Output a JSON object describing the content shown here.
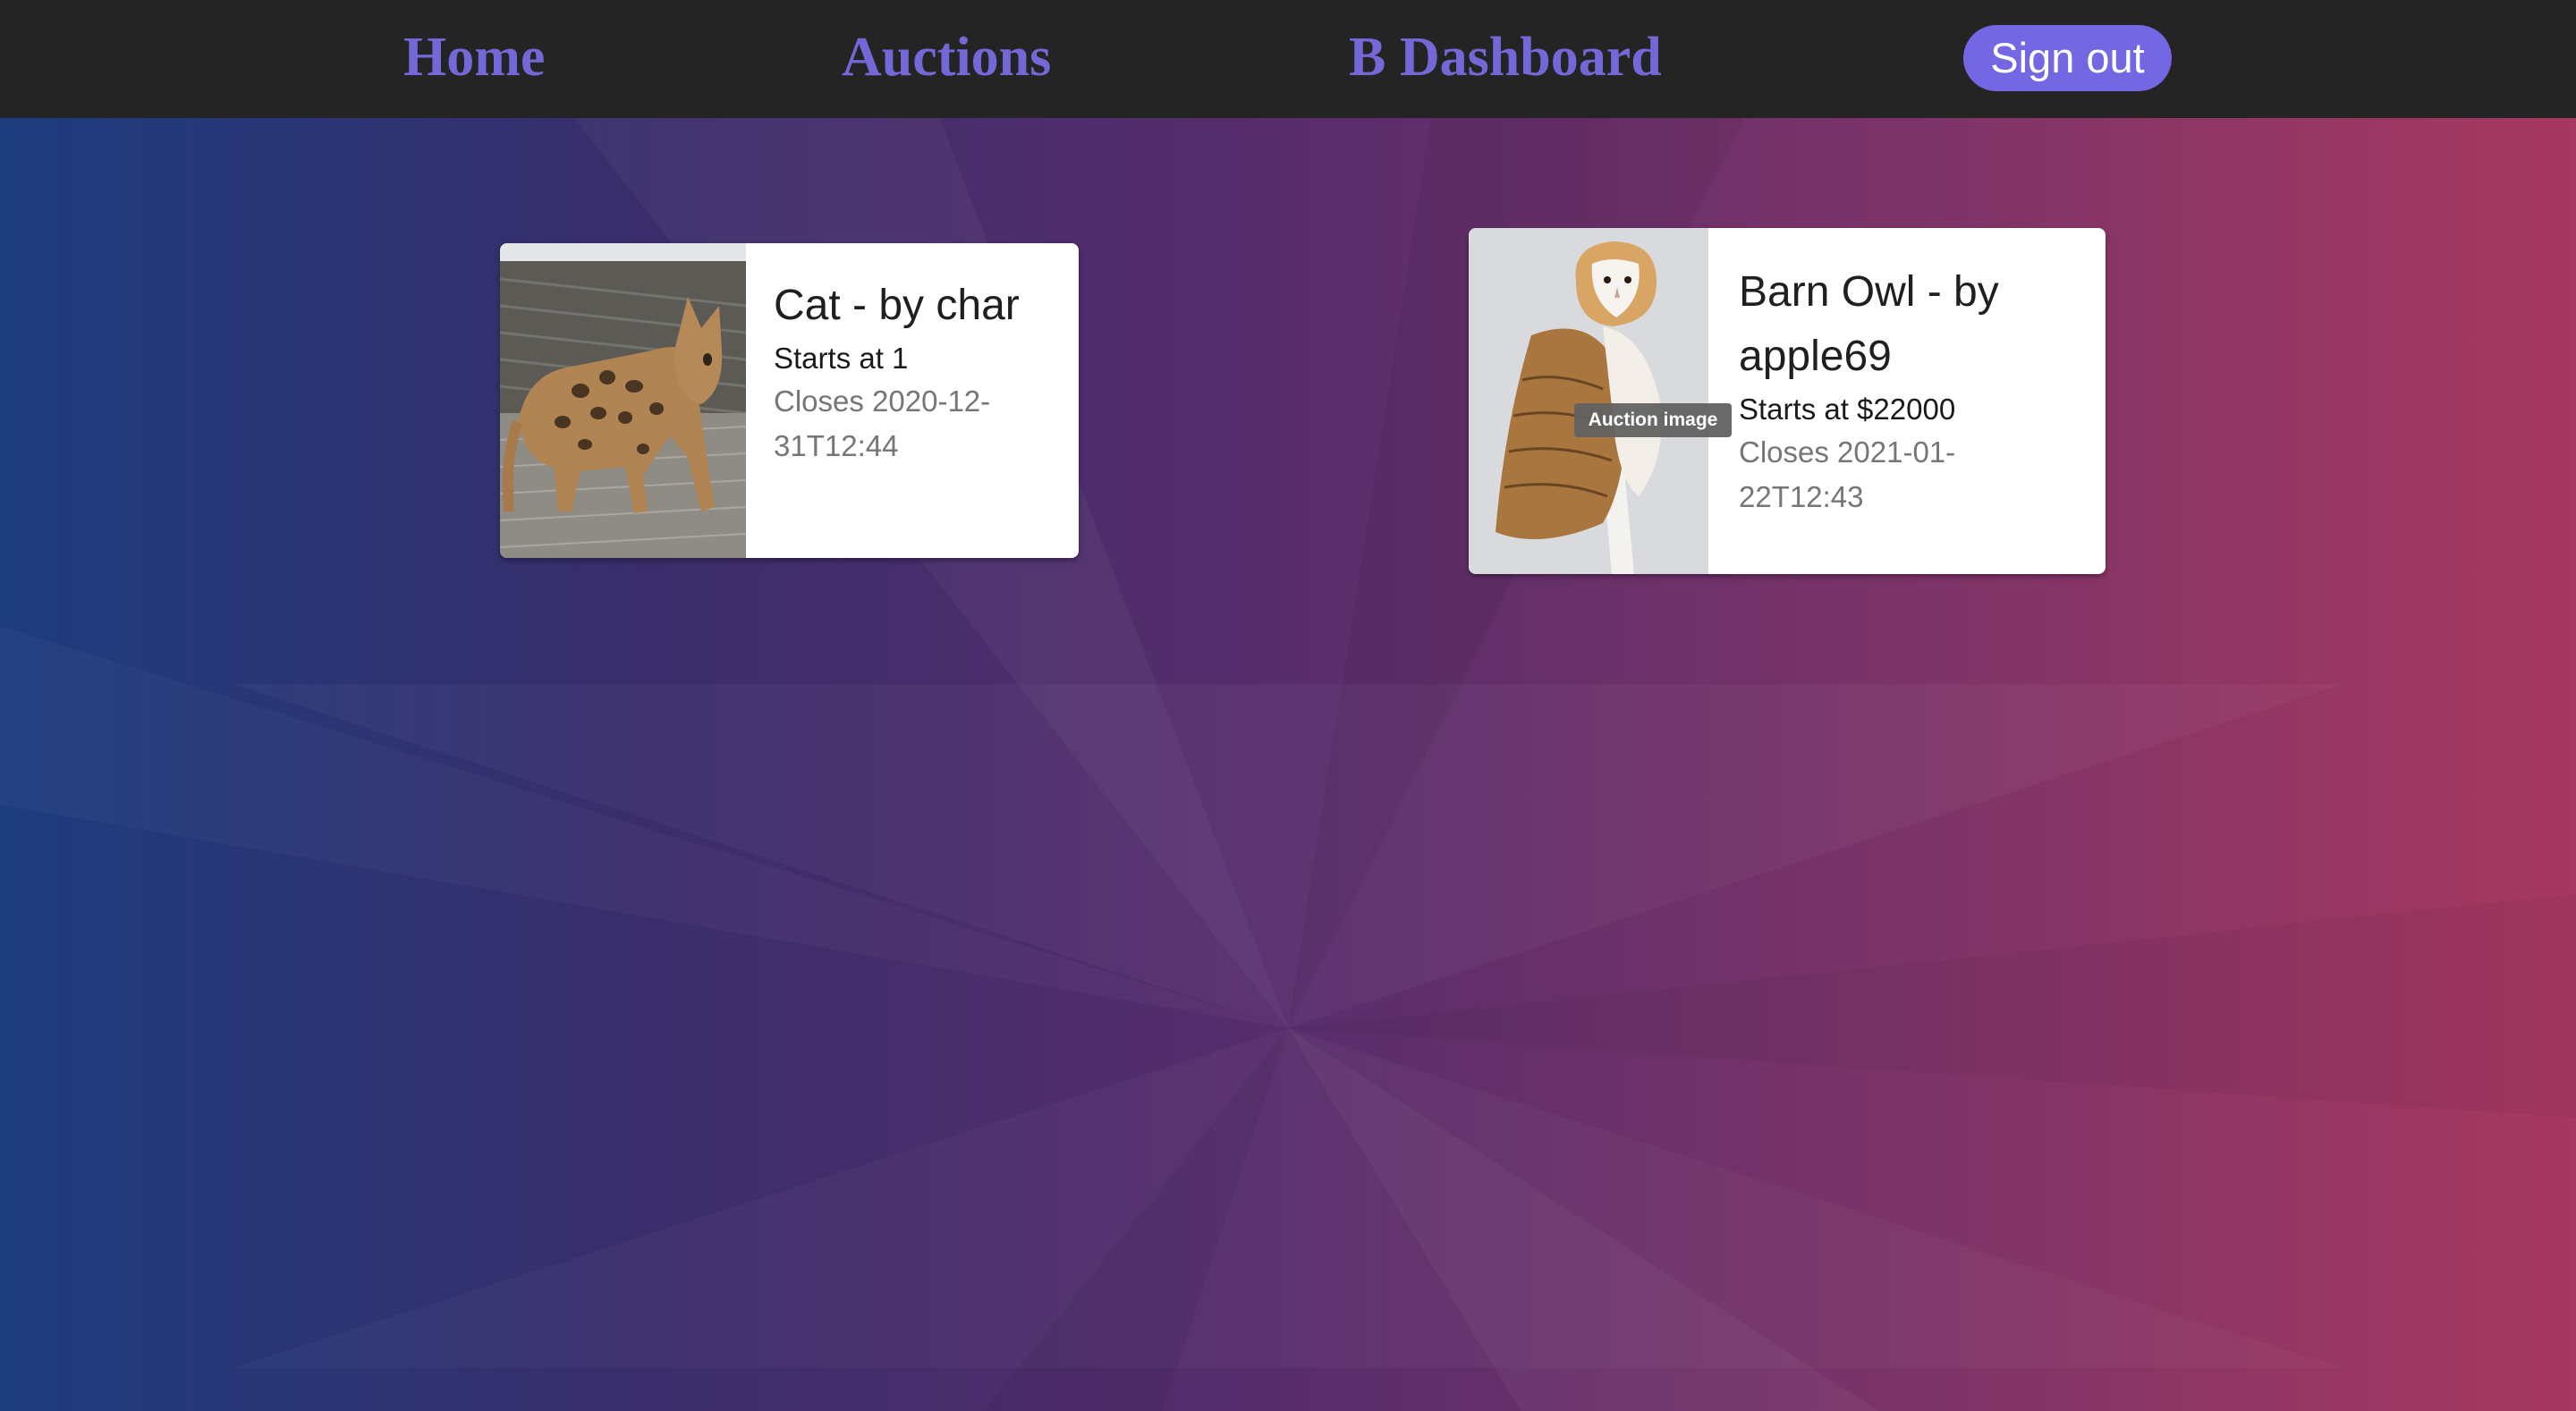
{
  "nav": {
    "home_label": "Home",
    "auctions_label": "Auctions",
    "dashboard_label": "B Dashboard",
    "signout_label": "Sign out"
  },
  "auctions": [
    {
      "title": "Cat - by char",
      "starts": "Starts at 1",
      "closes": "Closes 2020-12-31T12:44",
      "image_alt": "Auction image"
    },
    {
      "title": "Barn Owl - by apple69",
      "starts": "Starts at $22000",
      "closes": "Closes 2021-01-22T12:43",
      "image_alt": "Auction image"
    }
  ],
  "tooltip": {
    "text": "Auction image"
  },
  "colors": {
    "nav_background": "#242424",
    "nav_link": "#7468d8",
    "signout_background": "#7367e3",
    "gradient_left": "#1c3c7e",
    "gradient_right": "#a7385f"
  }
}
